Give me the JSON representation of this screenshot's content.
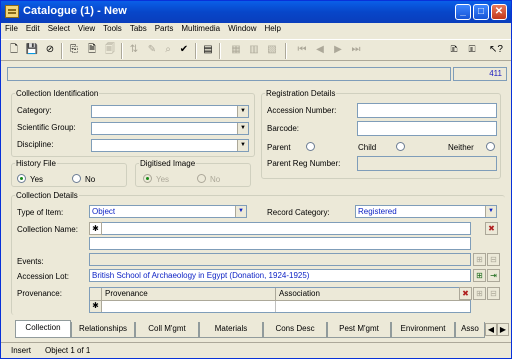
{
  "window": {
    "title": "Catalogue (1) - New"
  },
  "menu": [
    "File",
    "Edit",
    "Select",
    "View",
    "Tools",
    "Tabs",
    "Parts",
    "Multimedia",
    "Window",
    "Help"
  ],
  "record_count": "411",
  "collection_identification": {
    "legend": "Collection Identification",
    "category_label": "Category:",
    "category_value": "",
    "scientific_group_label": "Scientific Group:",
    "scientific_group_value": "",
    "discipline_label": "Discipline:",
    "discipline_value": ""
  },
  "registration": {
    "legend": "Registration Details",
    "accession_number_label": "Accession Number:",
    "barcode_label": "Barcode:",
    "parent_label": "Parent",
    "child_label": "Child",
    "neither_label": "Neither",
    "parent_reg_label": "Parent Reg Number:"
  },
  "history_file": {
    "legend": "History File",
    "yes": "Yes",
    "no": "No",
    "selected": "Yes"
  },
  "digitised_image": {
    "legend": "Digitised Image",
    "yes": "Yes",
    "no": "No",
    "selected": "Yes"
  },
  "collection_details": {
    "legend": "Collection Details",
    "type_label": "Type of Item:",
    "type_value": "Object",
    "record_category_label": "Record Category:",
    "record_category_value": "Registered",
    "collection_name_label": "Collection Name:",
    "events_label": "Events:",
    "accession_lot_label": "Accession Lot:",
    "accession_lot_value": "British School of Archaeology in Egypt (Donation, 1924-1925)",
    "provenance_label": "Provenance:",
    "grid_columns": [
      "Provenance",
      "Association"
    ]
  },
  "tabs": [
    "Collection",
    "Relationships",
    "Coll M'gmt",
    "Materials",
    "Cons Desc",
    "Pest M'gmt",
    "Environment",
    "Asso"
  ],
  "status": {
    "mode": "Insert",
    "object": "Object 1 of 1"
  },
  "colors": {
    "accent": "#0a1fc4",
    "titlebar": "#0746c9"
  }
}
